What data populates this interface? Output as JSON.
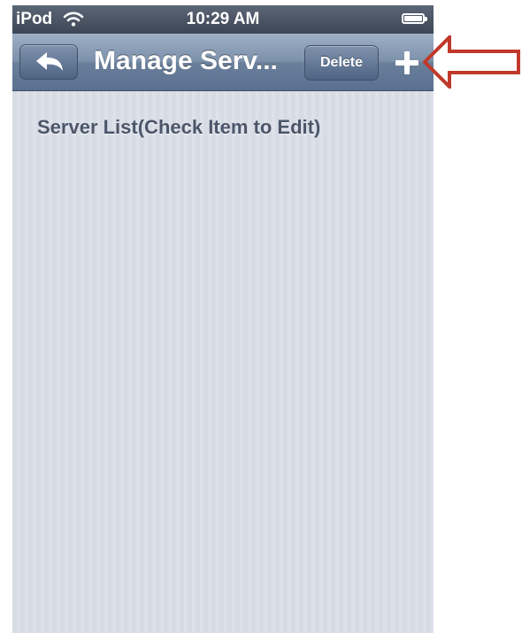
{
  "status_bar": {
    "carrier": "iPod",
    "time": "10:29 AM",
    "wifi_icon": "wifi-icon",
    "battery_icon": "battery-icon"
  },
  "nav_bar": {
    "back_icon": "back-arrow-icon",
    "title": "Manage Serv...",
    "delete_label": "Delete",
    "add_icon": "plus-icon"
  },
  "content": {
    "section_header": "Server List(Check Item to Edit)"
  },
  "annotation": {
    "arrow_icon": "arrow-left-annotation",
    "color": "#c0392b"
  },
  "colors": {
    "nav_bar": "#7d91ab",
    "background": "#d9dde6",
    "header_text": "#4c566a"
  }
}
